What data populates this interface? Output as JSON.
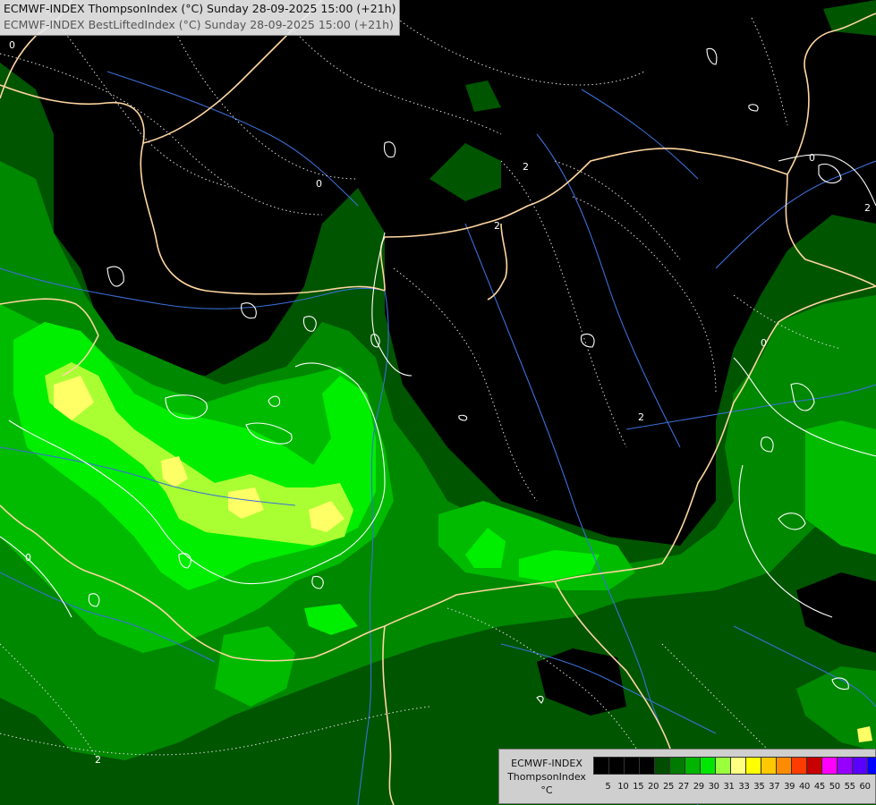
{
  "header": {
    "line1": "ECMWF-INDEX ThompsonIndex (°C) Sunday 28-09-2025 15:00 (+21h)",
    "line2": "ECMWF-INDEX BestLiftedIndex (°C) Sunday 28-09-2025 15:00 (+21h)"
  },
  "legend": {
    "title_line1": "ECMWF-INDEX",
    "title_line2": "ThompsonIndex",
    "unit": "°C",
    "ticks": [
      "5",
      "10",
      "15",
      "20",
      "25",
      "27",
      "29",
      "30",
      "31",
      "33",
      "35",
      "37",
      "39",
      "40",
      "45",
      "50",
      "55",
      "60"
    ],
    "colors": [
      "#000000",
      "#000000",
      "#000000",
      "#000000",
      "#004d00",
      "#007a00",
      "#00b400",
      "#00e600",
      "#9aff3c",
      "#ffff82",
      "#ffff00",
      "#ffc800",
      "#ff8c00",
      "#ff3c00",
      "#c80000",
      "#ff00ff",
      "#9600ff",
      "#5a00ff",
      "#0000ff"
    ]
  },
  "map": {
    "contour_labels": [
      "0",
      "0",
      "2",
      "2",
      "2",
      "0",
      "0",
      "2",
      "0",
      "2"
    ],
    "colors": {
      "background": "#000000",
      "dark_green": "#005500",
      "mid_green": "#008800",
      "green": "#00bb00",
      "bright_green": "#00ee00",
      "lime": "#aaff33",
      "yellow": "#ffff66",
      "border": "#ffd6a0",
      "river": "#3a6fd8",
      "contour": "#ffffff"
    }
  }
}
